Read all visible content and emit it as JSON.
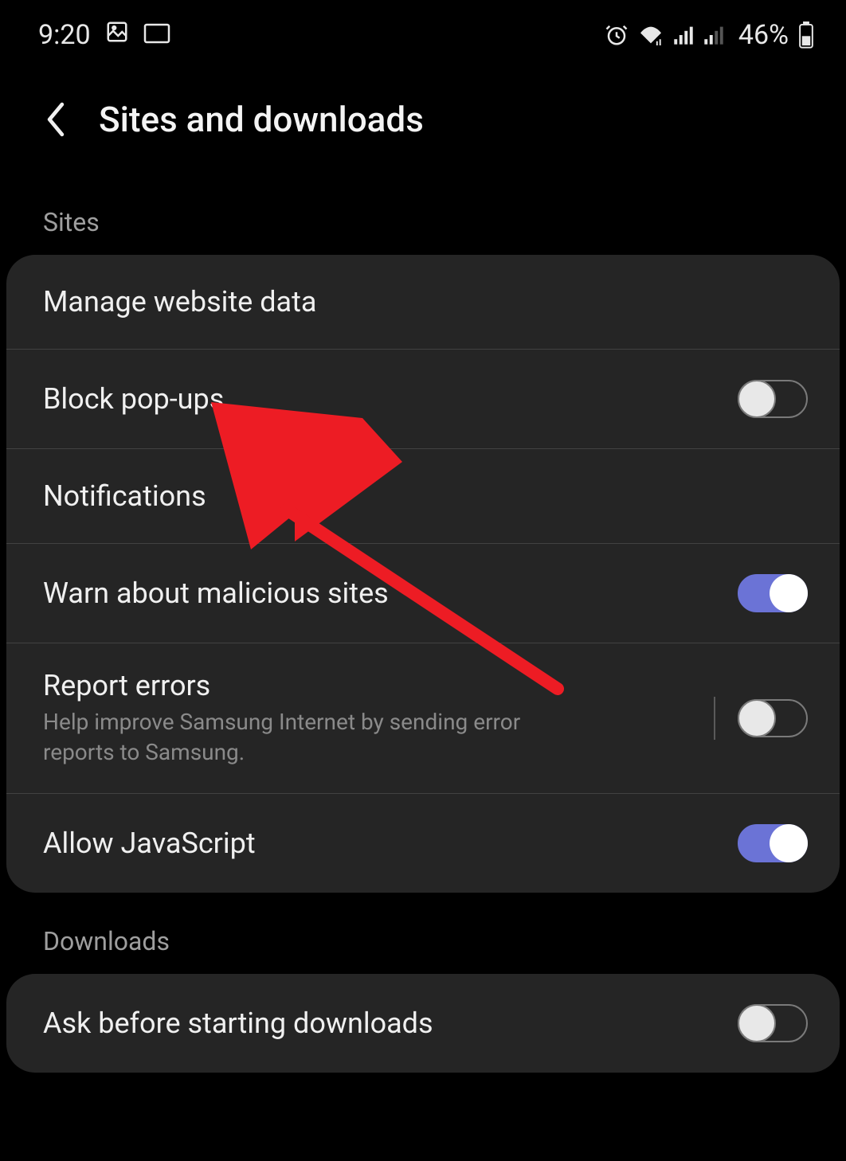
{
  "status_bar": {
    "time": "9:20",
    "battery": "46%"
  },
  "header": {
    "title": "Sites and downloads"
  },
  "sections": {
    "sites_header": "Sites",
    "downloads_header": "Downloads"
  },
  "settings": {
    "manage_website_data": {
      "label": "Manage website data"
    },
    "block_popups": {
      "label": "Block pop-ups",
      "on": false
    },
    "notifications": {
      "label": "Notifications"
    },
    "warn_malicious": {
      "label": "Warn about malicious sites",
      "on": true
    },
    "report_errors": {
      "label": "Report errors",
      "subtitle": "Help improve Samsung Internet by sending error reports to Samsung.",
      "on": false
    },
    "allow_js": {
      "label": "Allow JavaScript",
      "on": true
    },
    "ask_downloads": {
      "label": "Ask before starting downloads",
      "on": false
    }
  }
}
